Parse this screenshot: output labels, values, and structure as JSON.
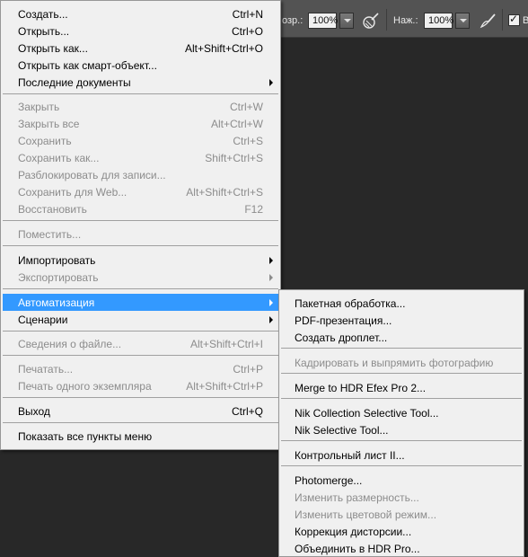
{
  "optbar": {
    "opacity_label_partial": "озр.:",
    "opacity_value": "100%",
    "pressure_label": "Наж.:",
    "pressure_value": "100%",
    "checkbox_label_partial": "В"
  },
  "file_menu": {
    "items": [
      {
        "label": "Создать...",
        "shortcut": "Ctrl+N",
        "enabled": true
      },
      {
        "label": "Открыть...",
        "shortcut": "Ctrl+O",
        "enabled": true
      },
      {
        "label": "Открыть как...",
        "shortcut": "Alt+Shift+Ctrl+O",
        "enabled": true
      },
      {
        "label": "Открыть как смарт-объект...",
        "shortcut": "",
        "enabled": true
      },
      {
        "label": "Последние документы",
        "shortcut": "",
        "enabled": true,
        "submenu": true
      },
      {
        "label": "Закрыть",
        "shortcut": "Ctrl+W",
        "enabled": false
      },
      {
        "label": "Закрыть все",
        "shortcut": "Alt+Ctrl+W",
        "enabled": false
      },
      {
        "label": "Сохранить",
        "shortcut": "Ctrl+S",
        "enabled": false
      },
      {
        "label": "Сохранить как...",
        "shortcut": "Shift+Ctrl+S",
        "enabled": false
      },
      {
        "label": "Разблокировать для записи...",
        "shortcut": "",
        "enabled": false
      },
      {
        "label": "Сохранить для Web...",
        "shortcut": "Alt+Shift+Ctrl+S",
        "enabled": false
      },
      {
        "label": "Восстановить",
        "shortcut": "F12",
        "enabled": false
      },
      {
        "label": "Поместить...",
        "shortcut": "",
        "enabled": false
      },
      {
        "label": "Импортировать",
        "shortcut": "",
        "enabled": true,
        "submenu": true
      },
      {
        "label": "Экспортировать",
        "shortcut": "",
        "enabled": false,
        "submenu": true
      },
      {
        "label": "Автоматизация",
        "shortcut": "",
        "enabled": true,
        "submenu": true,
        "active": true
      },
      {
        "label": "Сценарии",
        "shortcut": "",
        "enabled": true,
        "submenu": true
      },
      {
        "label": "Сведения о файле...",
        "shortcut": "Alt+Shift+Ctrl+I",
        "enabled": false
      },
      {
        "label": "Печатать...",
        "shortcut": "Ctrl+P",
        "enabled": false
      },
      {
        "label": "Печать одного экземпляра",
        "shortcut": "Alt+Shift+Ctrl+P",
        "enabled": false
      },
      {
        "label": "Выход",
        "shortcut": "Ctrl+Q",
        "enabled": true
      },
      {
        "label": "Показать все пункты меню",
        "shortcut": "",
        "enabled": true
      }
    ]
  },
  "automation_menu": {
    "items": [
      {
        "label": "Пакетная обработка...",
        "enabled": true
      },
      {
        "label": "PDF-презентация...",
        "enabled": true
      },
      {
        "label": "Создать дроплет...",
        "enabled": true
      },
      {
        "label": "Кадрировать и выпрямить фотографию",
        "enabled": false
      },
      {
        "label": "Merge to HDR Efex Pro 2...",
        "enabled": true
      },
      {
        "label": "Nik Collection Selective Tool...",
        "enabled": true
      },
      {
        "label": "Nik Selective Tool...",
        "enabled": true
      },
      {
        "label": "Контрольный лист II...",
        "enabled": true
      },
      {
        "label": "Photomerge...",
        "enabled": true
      },
      {
        "label": "Изменить размерность...",
        "enabled": false
      },
      {
        "label": "Изменить цветовой режим...",
        "enabled": false
      },
      {
        "label": "Коррекция дисторсии...",
        "enabled": true
      },
      {
        "label": "Объединить в HDR Pro...",
        "enabled": true
      }
    ]
  }
}
